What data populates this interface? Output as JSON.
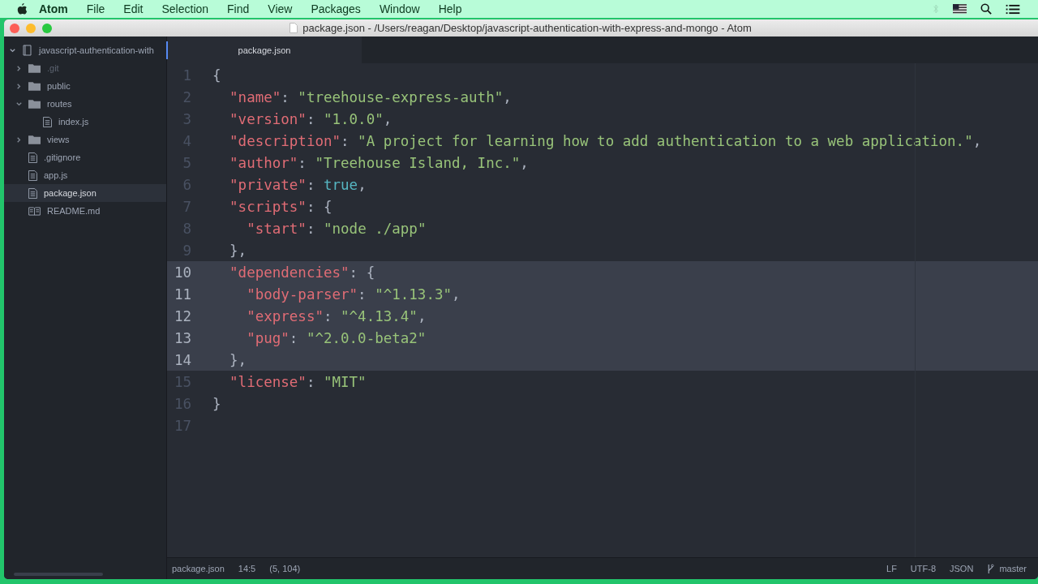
{
  "menu_bar": {
    "app": "Atom",
    "items": [
      "File",
      "Edit",
      "Selection",
      "Find",
      "View",
      "Packages",
      "Window",
      "Help"
    ]
  },
  "window": {
    "title": "package.json - /Users/reagan/Desktop/javascript-authentication-with-express-and-mongo - Atom"
  },
  "tree": {
    "project": "javascript-authentication-with",
    "items": [
      {
        "kind": "folder",
        "label": ".git",
        "expanded": false,
        "ignored": true,
        "selected": false
      },
      {
        "kind": "folder",
        "label": "public",
        "expanded": false,
        "ignored": false,
        "selected": false
      },
      {
        "kind": "folder",
        "label": "routes",
        "expanded": true,
        "ignored": false,
        "selected": false,
        "children": [
          {
            "kind": "file",
            "label": "index.js",
            "ignored": false,
            "selected": false
          }
        ]
      },
      {
        "kind": "folder",
        "label": "views",
        "expanded": false,
        "ignored": false,
        "selected": false
      },
      {
        "kind": "file",
        "label": ".gitignore",
        "ignored": false,
        "selected": false
      },
      {
        "kind": "file",
        "label": "app.js",
        "ignored": false,
        "selected": false
      },
      {
        "kind": "file",
        "label": "package.json",
        "ignored": false,
        "selected": true
      },
      {
        "kind": "book",
        "label": "README.md",
        "ignored": false,
        "selected": false
      }
    ]
  },
  "tabs": [
    {
      "label": "package.json",
      "selected": true
    }
  ],
  "editor": {
    "lines": [
      {
        "number": "1",
        "selected": false,
        "kind": "none",
        "tokens": [
          {
            "kind": "punct",
            "text": "{"
          }
        ]
      },
      {
        "number": "2",
        "selected": false,
        "kind": "inner",
        "tokens": [
          {
            "kind": "key",
            "text": "\"name\""
          },
          {
            "kind": "punct",
            "text": ": "
          },
          {
            "kind": "string",
            "text": "\"treehouse-express-auth\""
          },
          {
            "kind": "punct",
            "text": ","
          }
        ]
      },
      {
        "number": "3",
        "selected": false,
        "kind": "inner",
        "tokens": [
          {
            "kind": "key",
            "text": "\"version\""
          },
          {
            "kind": "punct",
            "text": ": "
          },
          {
            "kind": "string",
            "text": "\"1.0.0\""
          },
          {
            "kind": "punct",
            "text": ","
          }
        ]
      },
      {
        "number": "4",
        "selected": false,
        "kind": "inner",
        "tokens": [
          {
            "kind": "key",
            "text": "\"description\""
          },
          {
            "kind": "punct",
            "text": ": "
          },
          {
            "kind": "string",
            "text": "\"A project for learning how to add authentication to a web application.\""
          },
          {
            "kind": "punct",
            "text": ","
          }
        ]
      },
      {
        "number": "5",
        "selected": false,
        "kind": "inner",
        "tokens": [
          {
            "kind": "key",
            "text": "\"author\""
          },
          {
            "kind": "punct",
            "text": ": "
          },
          {
            "kind": "string",
            "text": "\"Treehouse Island, Inc.\""
          },
          {
            "kind": "punct",
            "text": ","
          }
        ]
      },
      {
        "number": "6",
        "selected": false,
        "kind": "inner",
        "tokens": [
          {
            "kind": "key",
            "text": "\"private\""
          },
          {
            "kind": "punct",
            "text": ": "
          },
          {
            "kind": "bool",
            "text": "true"
          },
          {
            "kind": "punct",
            "text": ","
          }
        ]
      },
      {
        "number": "7",
        "selected": false,
        "kind": "inner",
        "tokens": [
          {
            "kind": "key",
            "text": "\"scripts\""
          },
          {
            "kind": "punct",
            "text": ": {"
          }
        ]
      },
      {
        "number": "8",
        "selected": false,
        "kind": "deep",
        "tokens": [
          {
            "kind": "key",
            "text": "\"start\""
          },
          {
            "kind": "punct",
            "text": ": "
          },
          {
            "kind": "string",
            "text": "\"node ./app\""
          }
        ]
      },
      {
        "number": "9",
        "selected": false,
        "kind": "inner",
        "tokens": [
          {
            "kind": "punct",
            "text": "},"
          }
        ]
      },
      {
        "number": "10",
        "selected": true,
        "kind": "inner",
        "tokens": [
          {
            "kind": "key",
            "text": "\"dependencies\""
          },
          {
            "kind": "punct",
            "text": ": {"
          }
        ]
      },
      {
        "number": "11",
        "selected": true,
        "kind": "deep",
        "tokens": [
          {
            "kind": "key",
            "text": "\"body-parser\""
          },
          {
            "kind": "punct",
            "text": ": "
          },
          {
            "kind": "string",
            "text": "\"^1.13.3\""
          },
          {
            "kind": "punct",
            "text": ","
          }
        ]
      },
      {
        "number": "12",
        "selected": true,
        "kind": "deep",
        "tokens": [
          {
            "kind": "key",
            "text": "\"express\""
          },
          {
            "kind": "punct",
            "text": ": "
          },
          {
            "kind": "string",
            "text": "\"^4.13.4\""
          },
          {
            "kind": "punct",
            "text": ","
          }
        ]
      },
      {
        "number": "13",
        "selected": true,
        "kind": "deep",
        "tokens": [
          {
            "kind": "key",
            "text": "\"pug\""
          },
          {
            "kind": "punct",
            "text": ": "
          },
          {
            "kind": "string",
            "text": "\"^2.0.0-beta2\""
          }
        ]
      },
      {
        "number": "14",
        "selected": true,
        "kind": "inner",
        "tokens": [
          {
            "kind": "punct",
            "text": "},"
          }
        ]
      },
      {
        "number": "15",
        "selected": false,
        "kind": "inner",
        "tokens": [
          {
            "kind": "key",
            "text": "\"license\""
          },
          {
            "kind": "punct",
            "text": ": "
          },
          {
            "kind": "string",
            "text": "\"MIT\""
          }
        ]
      },
      {
        "number": "16",
        "selected": false,
        "kind": "none",
        "tokens": [
          {
            "kind": "punct",
            "text": "}"
          }
        ]
      },
      {
        "number": "17",
        "selected": false
      }
    ]
  },
  "status_bar": {
    "left": [
      "package.json",
      "14:5",
      "(5, 104)"
    ],
    "right": [
      "LF",
      "UTF-8",
      "JSON"
    ],
    "branch": "master"
  }
}
